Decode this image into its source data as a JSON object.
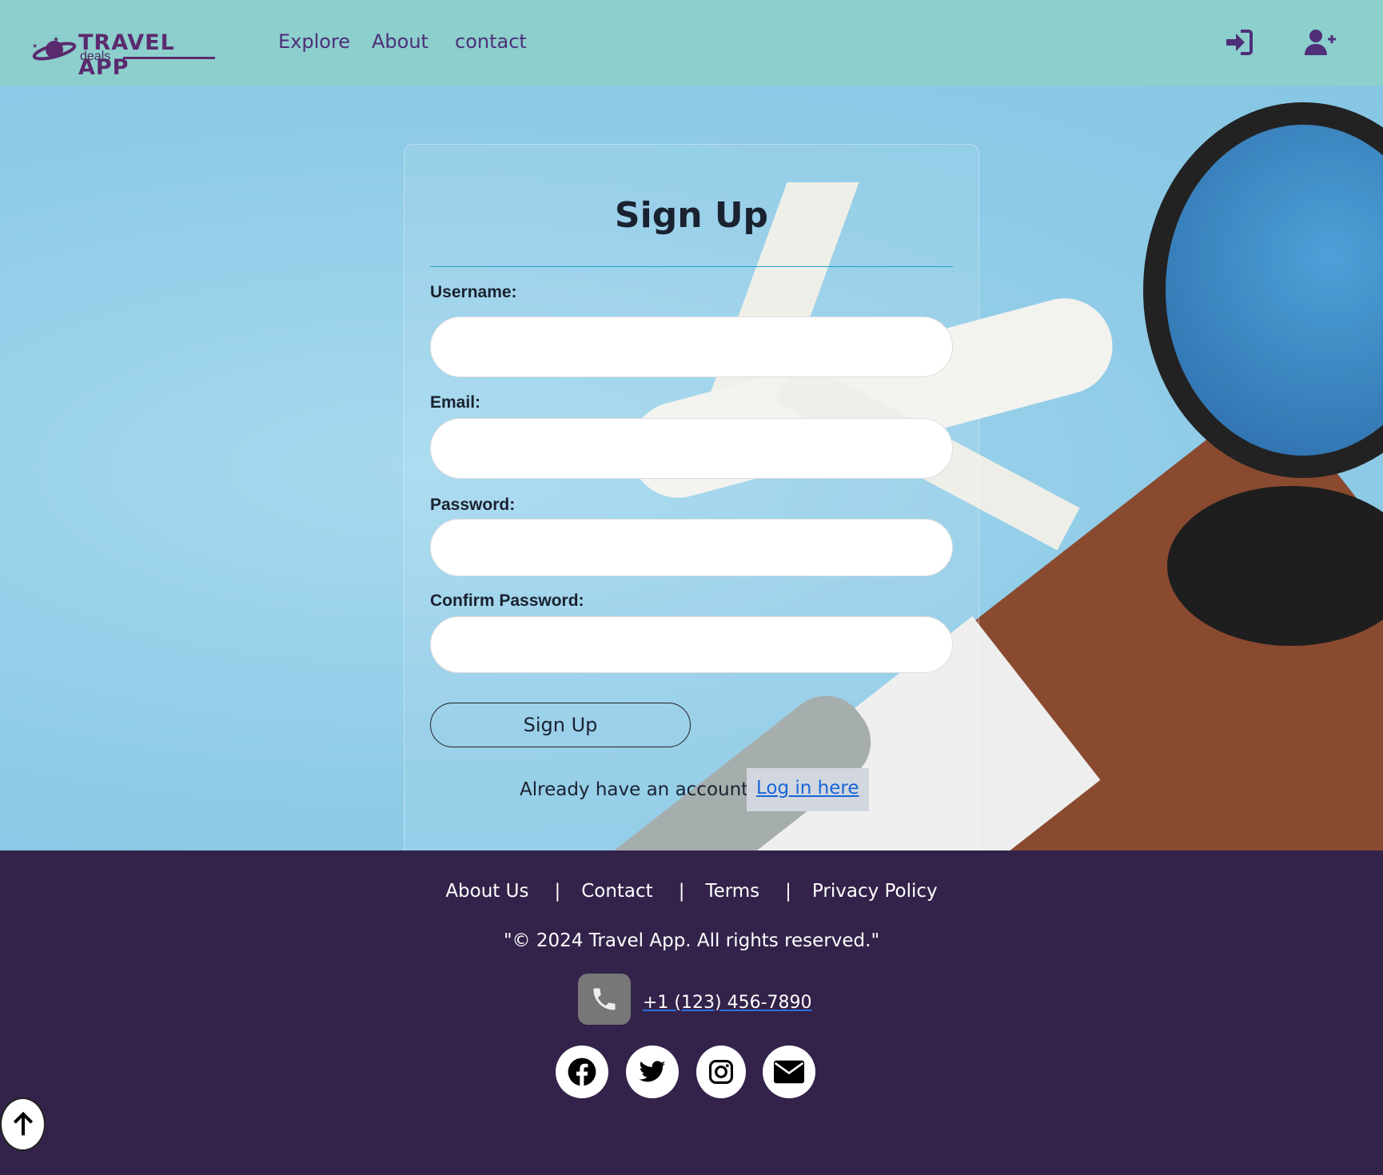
{
  "header": {
    "logo": {
      "title": "TRAVEL APP",
      "subtitle": "deals"
    },
    "nav": [
      {
        "label": "Explore"
      },
      {
        "label": "About"
      },
      {
        "label": "contact"
      }
    ],
    "icons": [
      "sign-in-icon",
      "user-plus-icon"
    ]
  },
  "form": {
    "title": "Sign Up",
    "fields": [
      {
        "label": "Username:",
        "value": ""
      },
      {
        "label": "Email:",
        "value": ""
      },
      {
        "label": "Password:",
        "value": ""
      },
      {
        "label": "Confirm Password:",
        "value": ""
      }
    ],
    "submit_label": "Sign Up",
    "already_text": "Already have an account?",
    "login_link": "Log in here"
  },
  "footer": {
    "links": [
      {
        "label": "About Us"
      },
      {
        "label": "Contact"
      },
      {
        "label": "Terms"
      },
      {
        "label": "Privacy Policy"
      }
    ],
    "separator": "|",
    "copyright": "\"© 2024 Travel App. All rights reserved.\"",
    "phone": " +1 (123) 456-7890",
    "social": [
      "facebook-icon",
      "twitter-icon",
      "instagram-icon",
      "email-icon"
    ]
  },
  "colors": {
    "header_bg": "#8ccfcd",
    "nav_text": "#4e2f78",
    "footer_bg": "#33234a",
    "link": "#1565d8"
  }
}
